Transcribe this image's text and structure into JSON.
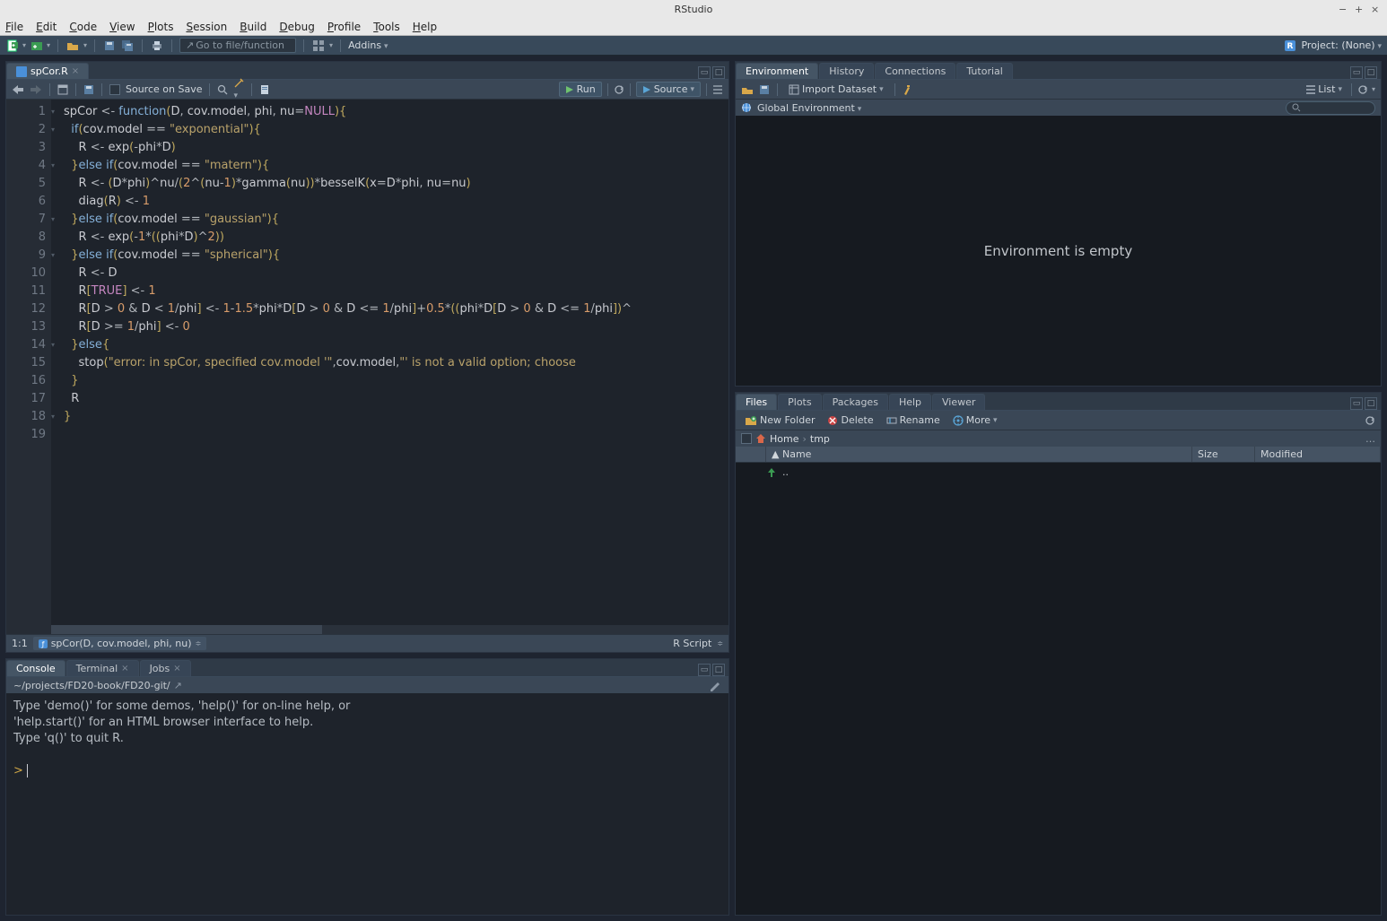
{
  "window": {
    "title": "RStudio"
  },
  "menu": {
    "file": "File",
    "edit": "Edit",
    "code": "Code",
    "view": "View",
    "plots": "Plots",
    "session": "Session",
    "build": "Build",
    "debug": "Debug",
    "profile": "Profile",
    "tools": "Tools",
    "help": "Help"
  },
  "maintb": {
    "gotofile": "Go to file/function",
    "addins": "Addins",
    "project": "Project: (None)"
  },
  "editor": {
    "tab": "spCor.R",
    "source_on_save": "Source on Save",
    "run": "Run",
    "source": "Source",
    "status_pos": "1:1",
    "status_fn": "spCor(D, cov.model, phi, nu)",
    "status_lang": "R Script",
    "lines": [
      1,
      2,
      3,
      4,
      5,
      6,
      7,
      8,
      9,
      10,
      11,
      12,
      13,
      14,
      15,
      16,
      17,
      18,
      19
    ],
    "fold_lines": [
      1,
      2,
      4,
      7,
      9,
      14,
      18
    ]
  },
  "console": {
    "tabs": {
      "console": "Console",
      "terminal": "Terminal",
      "jobs": "Jobs"
    },
    "path": "~/projects/FD20-book/FD20-git/",
    "text1": "Type 'demo()' for some demos, 'help()' for on-line help, or",
    "text2": "'help.start()' for an HTML browser interface to help.",
    "text3": "Type 'q()' to quit R.",
    "prompt": ">"
  },
  "env": {
    "tabs": {
      "env": "Environment",
      "history": "History",
      "connections": "Connections",
      "tutorial": "Tutorial"
    },
    "import": "Import Dataset",
    "list": "List",
    "scope": "Global Environment",
    "search_ph": "",
    "empty": "Environment is empty"
  },
  "files": {
    "tabs": {
      "files": "Files",
      "plots": "Plots",
      "packages": "Packages",
      "help": "Help",
      "viewer": "Viewer"
    },
    "newfolder": "New Folder",
    "delete": "Delete",
    "rename": "Rename",
    "more": "More",
    "crumb1": "Home",
    "crumb2": "tmp",
    "cols": {
      "name": "Name",
      "size": "Size",
      "modified": "Modified"
    },
    "up": ".."
  }
}
